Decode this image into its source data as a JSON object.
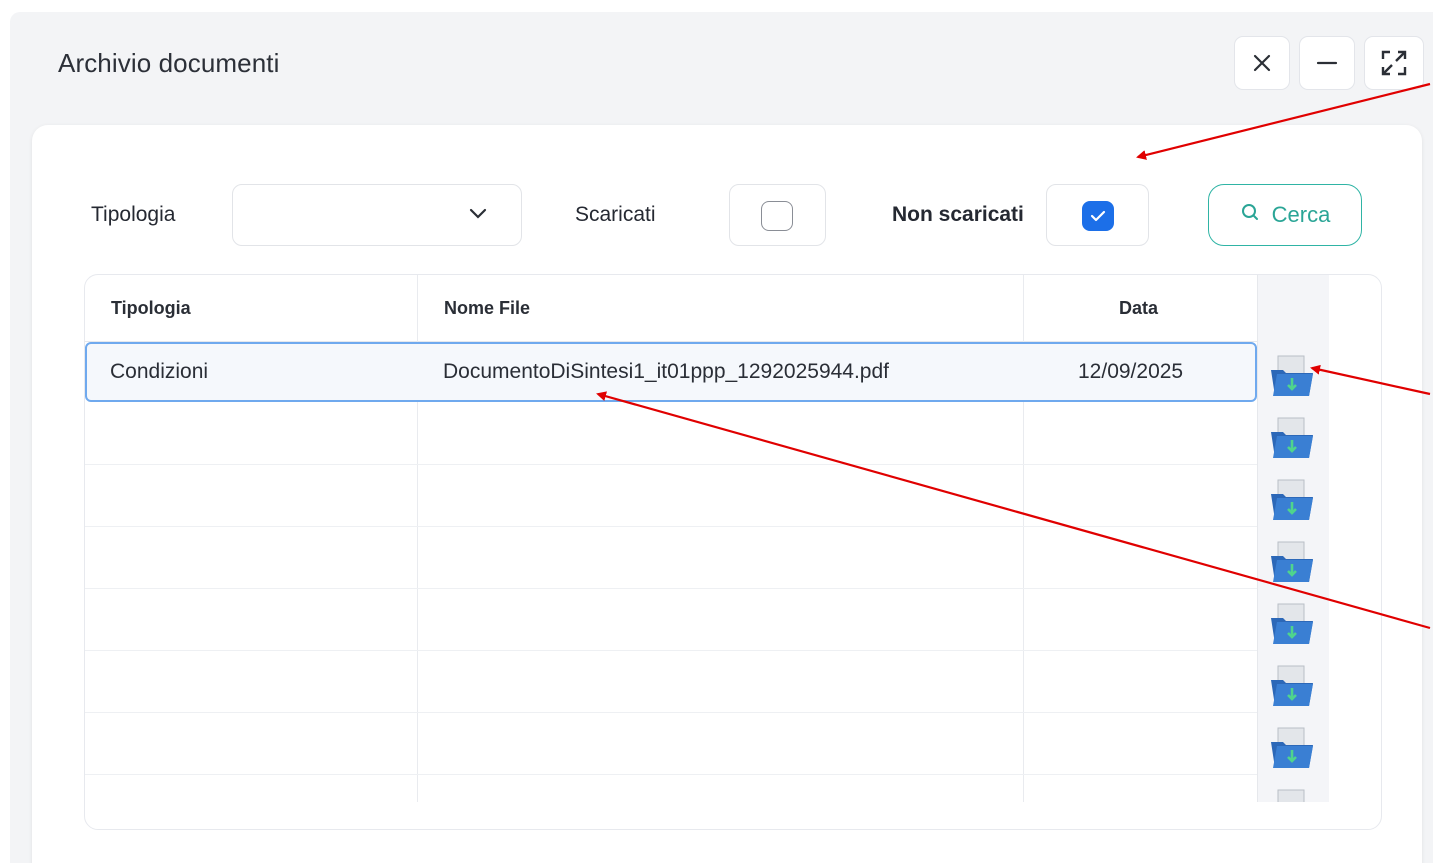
{
  "window": {
    "title": "Archivio documenti",
    "controls": [
      "close-icon",
      "minimize-icon",
      "maximize-icon"
    ]
  },
  "filters": {
    "tipologia_label": "Tipologia",
    "tipologia_value": "",
    "scaricati_label": "Scaricati",
    "scaricati_checked": false,
    "non_scaricati_label": "Non scaricati",
    "non_scaricati_checked": true,
    "search_label": "Cerca"
  },
  "table": {
    "columns": [
      "Tipologia",
      "Nome File",
      "Data"
    ],
    "rows": [
      {
        "tipologia": "Condizioni",
        "nome_file": "DocumentoDiSintesi1_it01ppp_1292025944.pdf",
        "data": "12/09/2025"
      }
    ],
    "download_icon": "download-folder-icon"
  },
  "colors": {
    "accent": "#2fb4a5",
    "checkbox": "#1c6fe8",
    "selection": "#6fa9ee",
    "annotation_arrow": "#e00000"
  }
}
